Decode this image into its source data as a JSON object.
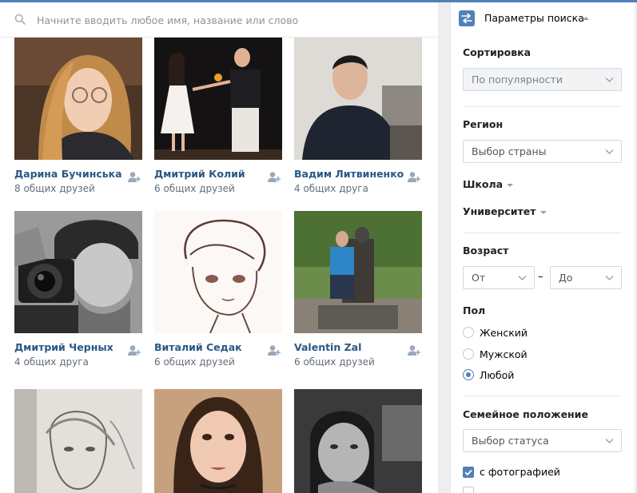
{
  "search": {
    "placeholder": "Начните вводить любое имя, название или слово",
    "value": ""
  },
  "people": [
    {
      "name": "Дарина Бучинська",
      "mutual": "8 общих друзей"
    },
    {
      "name": "Дмитрий Колий",
      "mutual": "6 общих друзей"
    },
    {
      "name": "Вадим Литвиненко",
      "mutual": "4 общих друга"
    },
    {
      "name": "Дмитрий Черных",
      "mutual": "4 общих друга"
    },
    {
      "name": "Виталий Седак",
      "mutual": "6 общих друзей"
    },
    {
      "name": "Valentin Zal",
      "mutual": "6 общих друзей"
    },
    {
      "name": "",
      "mutual": ""
    },
    {
      "name": "",
      "mutual": ""
    },
    {
      "name": "",
      "mutual": ""
    }
  ],
  "filters": {
    "title": "Параметры поиска",
    "sort": {
      "label": "Сортировка",
      "value": "По популярности"
    },
    "region": {
      "label": "Регион",
      "value": "Выбор страны"
    },
    "school": {
      "label": "Школа"
    },
    "university": {
      "label": "Университет"
    },
    "age": {
      "label": "Возраст",
      "from": "От",
      "dash": "–",
      "to": "До"
    },
    "gender": {
      "label": "Пол",
      "options": [
        "Женский",
        "Мужской",
        "Любой"
      ],
      "selected": "Любой"
    },
    "marital": {
      "label": "Семейное положение",
      "value": "Выбор статуса"
    },
    "with_photo": {
      "label": "с фотографией",
      "checked": true
    }
  },
  "colors": {
    "accent": "#5181b8",
    "link": "#2a5885",
    "muted": "#626d7a"
  }
}
